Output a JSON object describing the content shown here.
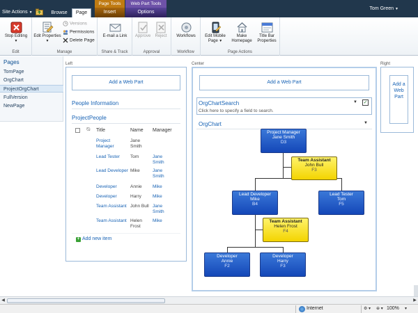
{
  "topbar": {
    "site_actions": "Site Actions",
    "tabs": [
      {
        "label": "Browse",
        "active": false
      },
      {
        "label": "Page",
        "active": true
      }
    ],
    "page_tools": {
      "title": "Page Tools",
      "tab": "Insert"
    },
    "webpart_tools": {
      "title": "Web Part Tools",
      "tab": "Options"
    },
    "user": "Tom Green"
  },
  "ribbon": {
    "edit_group": {
      "stop_editing": "Stop Editing",
      "label": "Edit"
    },
    "manage_group": {
      "edit_properties": "Edit Properties",
      "versions": "Versions",
      "permissions": "Permissions",
      "delete_page": "Delete Page",
      "label": "Manage"
    },
    "share_group": {
      "email_link": "E-mail a Link",
      "label": "Share & Track"
    },
    "approval_group": {
      "approve": "Approve",
      "reject": "Reject",
      "label": "Approval"
    },
    "workflow_group": {
      "workflows": "Workflows",
      "label": "Workflow"
    },
    "page_actions_group": {
      "edit_mobile_page": "Edit Mobile Page",
      "make_homepage": "Make Homepage",
      "title_bar_properties": "Title Bar Properties",
      "label": "Page Actions"
    }
  },
  "quicklaunch": {
    "heading": "Pages",
    "items": [
      {
        "label": "TomPage",
        "selected": false
      },
      {
        "label": "OrgChart",
        "selected": false
      },
      {
        "label": "ProjectOrgChart",
        "selected": true
      },
      {
        "label": "FullVersion",
        "selected": false
      },
      {
        "label": "NewPage",
        "selected": false
      }
    ]
  },
  "zones": {
    "left": {
      "label": "Left",
      "add_web_part": "Add a Web Part"
    },
    "center": {
      "label": "Center",
      "add_web_part": "Add a Web Part"
    },
    "right": {
      "label": "Right",
      "add_web_part": "Add a Web Part"
    }
  },
  "left_zone": {
    "people_information": "People Information",
    "list_title": "ProjectPeople",
    "columns": [
      "Title",
      "Name",
      "Manager"
    ],
    "rows": [
      {
        "title": "Project Manager",
        "name": "Jane Smith",
        "manager": ""
      },
      {
        "title": "Lead Tester",
        "name": "Tom",
        "manager": "Jane Smith"
      },
      {
        "title": "Lead Developer",
        "name": "Mike",
        "manager": "Jane Smith"
      },
      {
        "title": "Developer",
        "name": "Annie",
        "manager": "Mike"
      },
      {
        "title": "Developer",
        "name": "Harry",
        "manager": "Mike"
      },
      {
        "title": "Team Assistant",
        "name": "John Bull",
        "manager": "Jane Smith"
      },
      {
        "title": "Team Assistant",
        "name": "Helen Frost",
        "manager": "Mike"
      }
    ],
    "add_new_item": "Add new item"
  },
  "center_zone": {
    "orgchart_search_title": "OrgChartSearch",
    "orgchart_search_hint": "Click here to specify a field to search.",
    "orgchart_title": "OrgChart",
    "nodes": [
      {
        "id": "pm",
        "title": "Project Manager",
        "name": "Jane Smith",
        "code": "D3"
      },
      {
        "id": "ta1",
        "title": "Team Assistant",
        "name": "John Bull",
        "code": "F3"
      },
      {
        "id": "ld",
        "title": "Lead Developer",
        "name": "Mike",
        "code": "B4"
      },
      {
        "id": "lt",
        "title": "Lead Tester",
        "name": "Tom",
        "code": "F5"
      },
      {
        "id": "ta2",
        "title": "Team Assistant",
        "name": "Helen Frost",
        "code": "F4"
      },
      {
        "id": "dev1",
        "title": "Developer",
        "name": "Annie",
        "code": "F2"
      },
      {
        "id": "dev2",
        "title": "Developer",
        "name": "Harry",
        "code": "F3"
      }
    ]
  },
  "statusbar": {
    "zone": "Internet",
    "zoom": "100%"
  },
  "colors": {
    "topbar": "#21374c",
    "link": "#1863b5",
    "node_blue": "#1447b8",
    "node_yellow": "#f3d400"
  }
}
